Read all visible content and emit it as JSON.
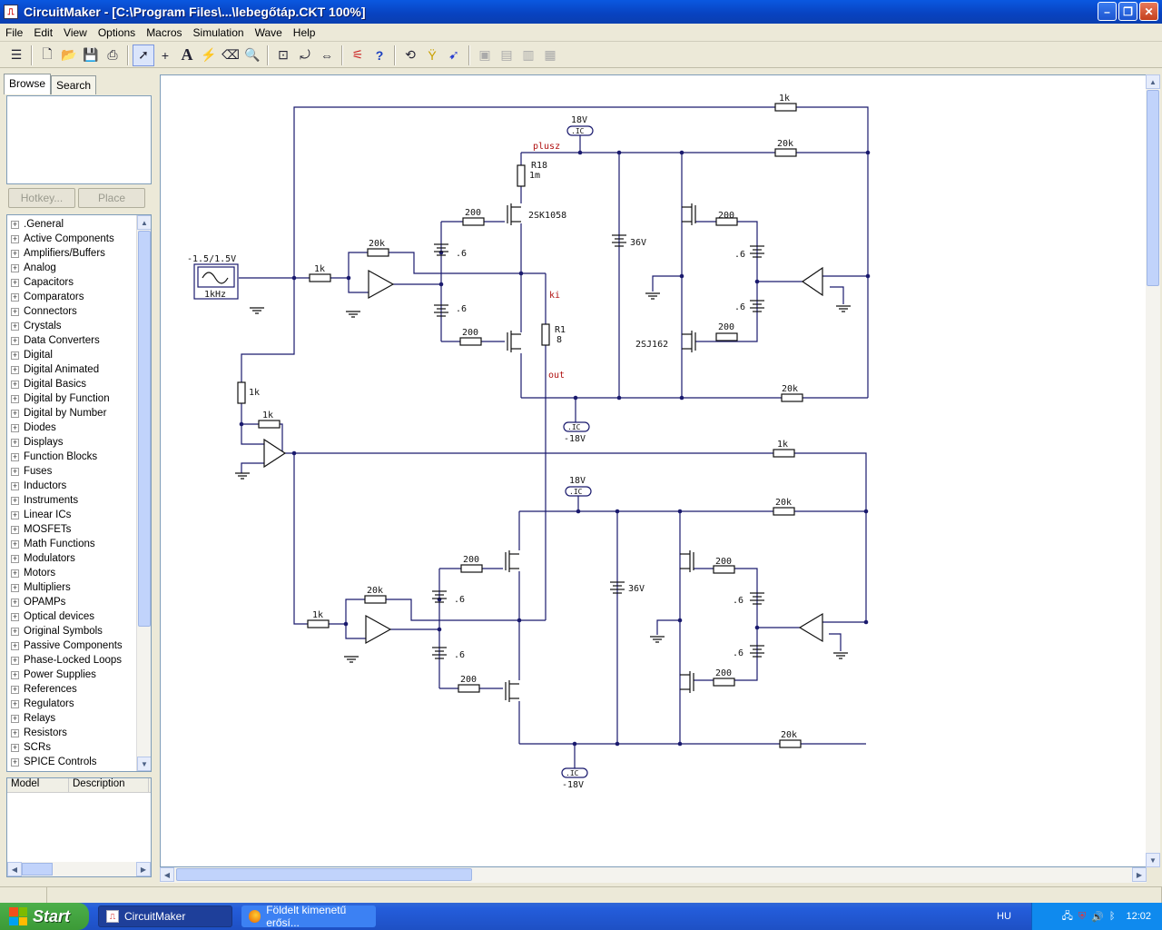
{
  "window": {
    "title": "CircuitMaker - [C:\\Program Files\\...\\lebegőtáp.CKT 100%]"
  },
  "menu": [
    "File",
    "Edit",
    "View",
    "Options",
    "Macros",
    "Simulation",
    "Wave",
    "Help"
  ],
  "left": {
    "tabs": [
      "Browse",
      "Search"
    ],
    "hotkey_label": "Hotkey...",
    "place_label": "Place",
    "library": [
      ".General",
      "Active Components",
      "Amplifiers/Buffers",
      "Analog",
      "Capacitors",
      "Comparators",
      "Connectors",
      "Crystals",
      "Data Converters",
      "Digital",
      "Digital Animated",
      "Digital Basics",
      "Digital by Function",
      "Digital by Number",
      "Diodes",
      "Displays",
      "Function Blocks",
      "Fuses",
      "Inductors",
      "Instruments",
      "Linear ICs",
      "MOSFETs",
      "Math Functions",
      "Modulators",
      "Motors",
      "Multipliers",
      "OPAMPs",
      "Optical devices",
      "Original Symbols",
      "Passive Components",
      "Phase-Locked Loops",
      "Power Supplies",
      "References",
      "Regulators",
      "Relays",
      "Resistors",
      "SCRs",
      "SPICE Controls"
    ],
    "model_cols": [
      "Model",
      "Description"
    ]
  },
  "schematic": {
    "source_label": "-1.5/1.5V",
    "freq_label": "1kHz",
    "pos_rail": "18V",
    "neg_rail": "-18V",
    "ic_tag": ".IC",
    "net_plus": "plusz",
    "net_ki": "ki",
    "net_out": "out",
    "r18": "R18",
    "r18_val": "1m",
    "r1": "R1",
    "r1_val": "8",
    "nmos": "2SK1058",
    "pmos": "2SJ162",
    "v36": "36V",
    "r_1k": "1k",
    "r_20k": "20k",
    "r_200": "200",
    "batt": ".6"
  },
  "taskbar": {
    "start": "Start",
    "tasks": [
      "CircuitMaker",
      "Földelt kimenetű erősí..."
    ],
    "lang": "HU",
    "clock": "12:02"
  }
}
